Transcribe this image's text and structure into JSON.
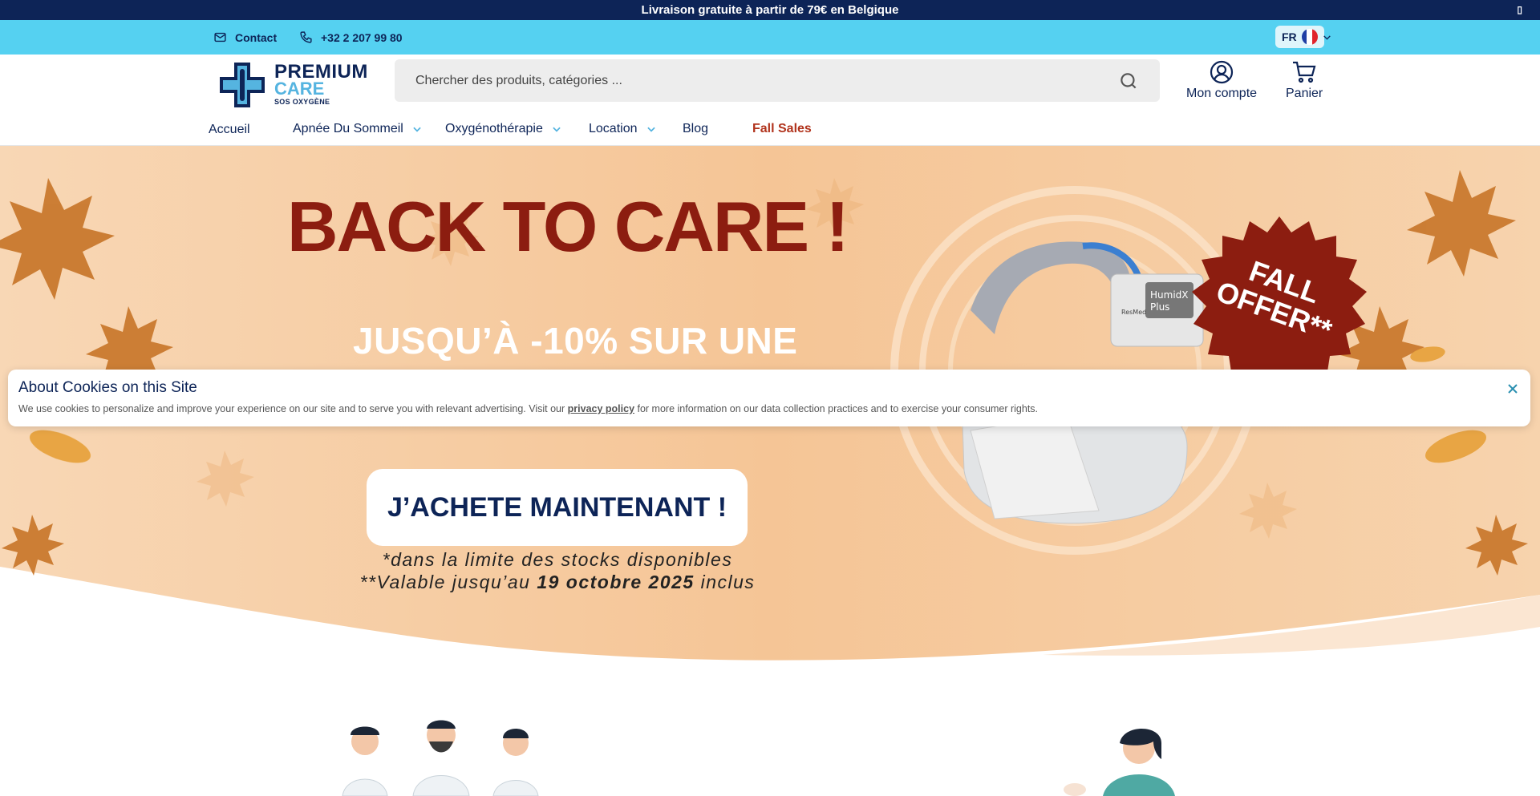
{
  "announcement": {
    "text": "Livraison gratuite à partir de 79€ en Belgique",
    "close": "▯"
  },
  "contact_bar": {
    "contact_label": "Contact",
    "phone": "+32 2 207 99 80",
    "language": "FR"
  },
  "header": {
    "logo": {
      "line1": "PREMIUM",
      "line2": "CARE",
      "line3": "SOS OXYGÈNE"
    },
    "search_placeholder": "Chercher des produits, catégories ...",
    "account_label": "Mon compte",
    "cart_label": "Panier"
  },
  "nav": {
    "items": [
      {
        "label": "Accueil"
      },
      {
        "label": "Apnée Du Sommeil"
      },
      {
        "label": "Oxygénothérapie"
      },
      {
        "label": "Location"
      },
      {
        "label": "Blog"
      },
      {
        "label": "Fall Sales"
      }
    ]
  },
  "hero": {
    "title": "BACK TO CARE !",
    "subtitle": "JUSQU’À -10% SUR UNE",
    "cta": "J’ACHETE MAINTENANT !",
    "note1": "*dans la limite des stocks disponibles",
    "note2_prefix": "**Valable jusqu’au ",
    "note2_bold": "19 octobre 2025",
    "note2_suffix": " inclus",
    "badge_line1": "FALL",
    "badge_line2": "OFFER**",
    "product_label1": "HumidX",
    "product_label2": "Plus",
    "product_brand": "ResMed"
  },
  "cookie": {
    "title": "About Cookies on this Site",
    "text_before": "We use cookies to personalize and improve your experience on our site and to serve you with relevant advertising. Visit our ",
    "link": "privacy policy",
    "text_after": " for more information on our data collection practices and to exercise your consumer rights."
  },
  "colors": {
    "navy": "#0d2457",
    "cyan": "#55d1f1",
    "hero_bg": "#f5c99a",
    "title_red": "#8c1d10",
    "sale_red": "#b1331c"
  }
}
